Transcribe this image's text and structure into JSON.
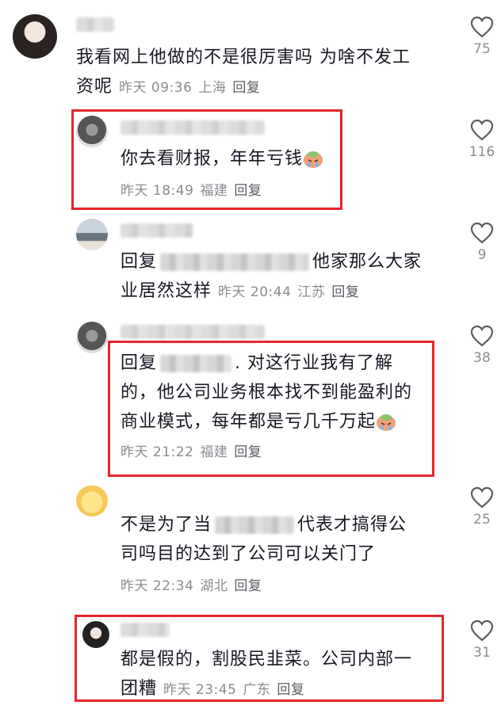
{
  "comments": [
    {
      "text_line1": "我看网上他做的不是很厉害吗 为啥不发工",
      "text_line2": "资呢",
      "time": "昨天 09:36",
      "location": "上海",
      "reply_label": "回复",
      "likes": "75"
    },
    {
      "text": "你去看财报，年年亏钱",
      "time": "昨天 18:49",
      "location": "福建",
      "reply_label": "回复",
      "likes": "116"
    },
    {
      "prefix": "回复",
      "text_line1_suffix": "他家那么大家",
      "text_line2": "业居然这样",
      "time": "昨天 20:44",
      "location": "江苏",
      "reply_label": "回复",
      "likes": "9"
    },
    {
      "prefix": "回复",
      "text_line1_suffix": ". 对这行业我有了解",
      "text_line2": "的，他公司业务根本找不到能盈利的",
      "text_line3": "商业模式，每年都是亏几千万起",
      "time": "昨天 21:22",
      "location": "福建",
      "reply_label": "回复",
      "likes": "38"
    },
    {
      "text_line1_prefix": "不是为了当",
      "text_line1_suffix": "代表才搞得公",
      "text_line2": "司吗目的达到了公司可以关门了",
      "time": "昨天 22:34",
      "location": "湖北",
      "reply_label": "回复",
      "likes": "25"
    },
    {
      "text_line1": "都是假的，割股民韭菜。公司内部一",
      "text_line2": "团糟",
      "time": "昨天 23:45",
      "location": "广东",
      "reply_label": "回复",
      "likes": "31"
    }
  ],
  "colors": {
    "highlight_box": "#e5262d",
    "meta_text": "#8a8b91",
    "body_text": "#161823"
  },
  "icons": {
    "like": "heart-outline-icon",
    "emoji": "crying-face-emoji"
  }
}
